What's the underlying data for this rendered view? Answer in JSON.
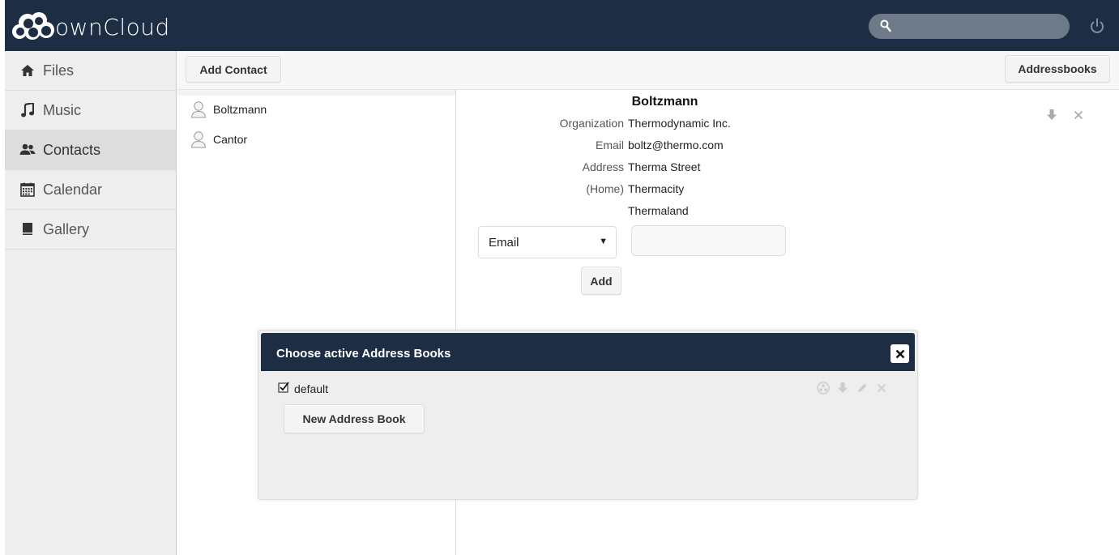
{
  "header": {
    "brand_text": "ownCloud",
    "search_placeholder": "",
    "colors": {
      "header_bg": "#1d2d44",
      "search_bg": "#6e7a89"
    }
  },
  "sidebar": {
    "items": [
      {
        "label": "Files",
        "icon": "home-icon",
        "active": false
      },
      {
        "label": "Music",
        "icon": "music-icon",
        "active": false
      },
      {
        "label": "Contacts",
        "icon": "users-icon",
        "active": true
      },
      {
        "label": "Calendar",
        "icon": "calendar-icon",
        "active": false
      },
      {
        "label": "Gallery",
        "icon": "gallery-icon",
        "active": false
      }
    ]
  },
  "controls": {
    "add_contact_label": "Add Contact",
    "addressbooks_label": "Addressbooks"
  },
  "contacts": [
    {
      "name": "Boltzmann"
    },
    {
      "name": "Cantor"
    }
  ],
  "contact_detail": {
    "fn": "Boltzmann",
    "organization_label": "Organization",
    "organization": "Thermodynamic Inc.",
    "email_label": "Email",
    "email": "boltz@thermo.com",
    "address_label": "Address",
    "address_type_label": "(Home)",
    "address_lines": [
      "Therma Street",
      "Thermacity",
      "Thermaland"
    ],
    "new_prop_selected": "Email",
    "new_prop_value": "",
    "add_label": "Add"
  },
  "dialog": {
    "title": "Choose active Address Books",
    "addressbook_name": "default",
    "addressbook_checked": true,
    "new_addressbook_label": "New Address Book"
  }
}
